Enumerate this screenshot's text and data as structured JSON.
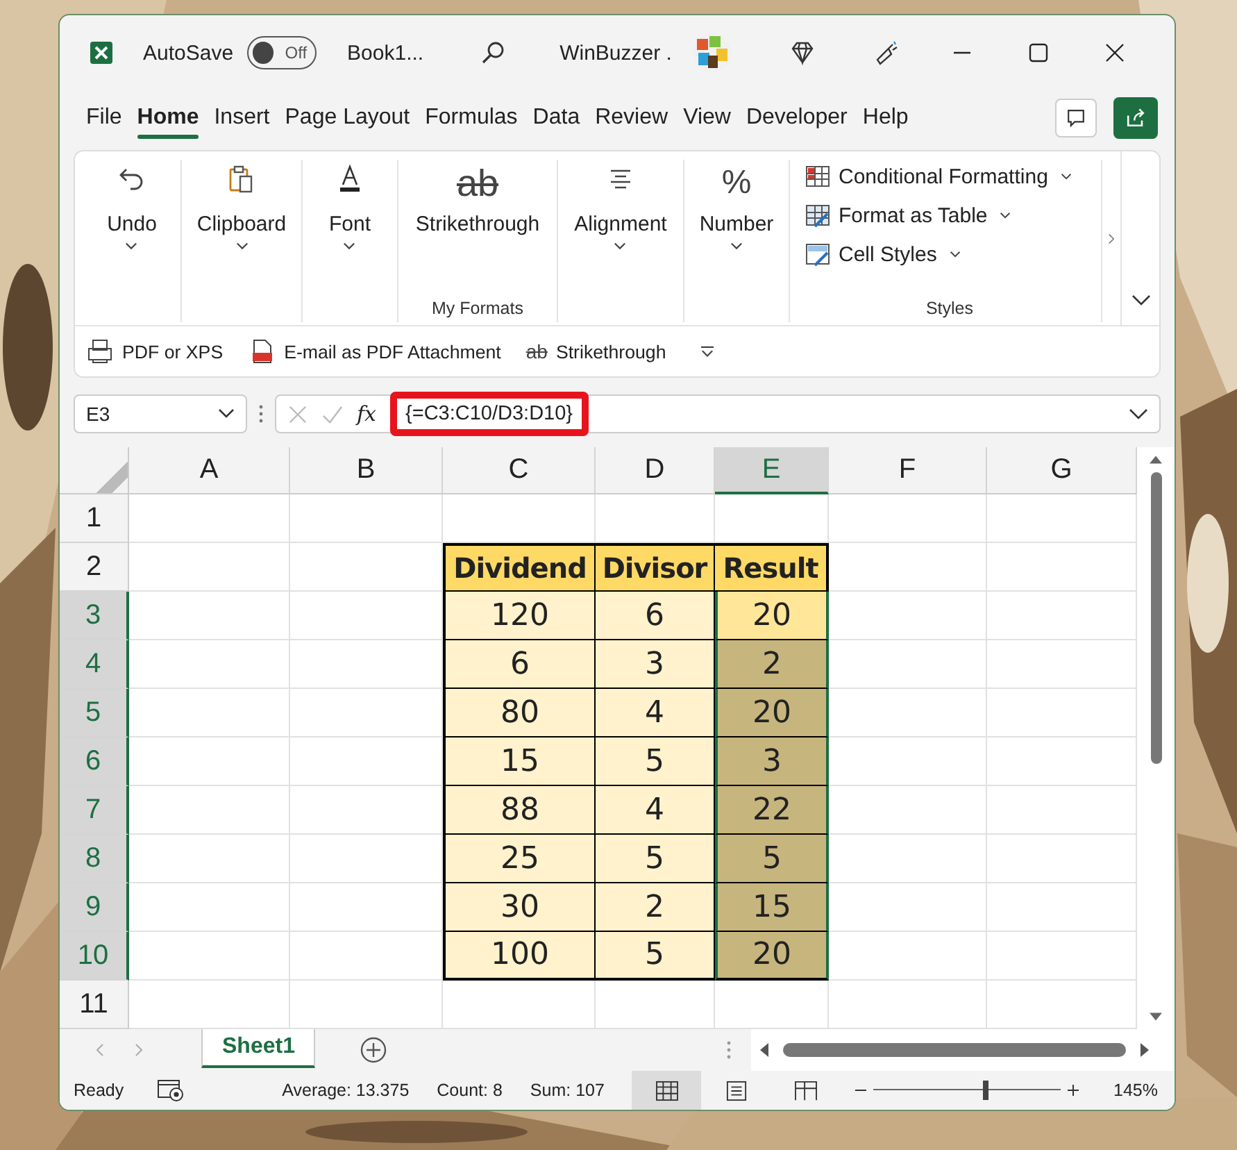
{
  "title_bar": {
    "autosave": {
      "label": "AutoSave",
      "on": false,
      "state_text": "Off"
    },
    "document": "Book1...",
    "account": "WinBuzzer ."
  },
  "menu_tabs": [
    {
      "label": "File",
      "selected": false
    },
    {
      "label": "Home",
      "selected": true
    },
    {
      "label": "Insert",
      "selected": false
    },
    {
      "label": "Page Layout",
      "selected": false
    },
    {
      "label": "Formulas",
      "selected": false
    },
    {
      "label": "Data",
      "selected": false
    },
    {
      "label": "Review",
      "selected": false
    },
    {
      "label": "View",
      "selected": false
    },
    {
      "label": "Developer",
      "selected": false
    },
    {
      "label": "Help",
      "selected": false
    }
  ],
  "ribbon": {
    "groups": [
      {
        "kind": "undo",
        "label": "Undo",
        "dropdown": true
      },
      {
        "kind": "clipboard",
        "label": "Clipboard",
        "dropdown": true
      },
      {
        "kind": "font",
        "label": "Font",
        "dropdown": true
      },
      {
        "kind": "glyph",
        "glyph": "ab",
        "label": "Strikethrough",
        "dropdown": false,
        "caption": "My Formats"
      },
      {
        "kind": "align",
        "label": "Alignment",
        "dropdown": true
      },
      {
        "kind": "text",
        "glyph": "%",
        "label": "Number",
        "dropdown": true
      }
    ],
    "styles": {
      "caption": "Styles",
      "items": [
        {
          "kind": "cond",
          "label": "Conditional Formatting"
        },
        {
          "kind": "table",
          "label": "Format as Table"
        },
        {
          "kind": "cellstyle",
          "label": "Cell Styles"
        }
      ]
    },
    "quick_access": [
      {
        "kind": "pdf",
        "label": "PDF or XPS"
      },
      {
        "kind": "email",
        "label": "E-mail as PDF Attachment"
      },
      {
        "kind": "strike",
        "glyph": "ab",
        "label": "Strikethrough"
      }
    ]
  },
  "formula_bar": {
    "name_box": "E3",
    "fx": "fx",
    "formula": "{=C3:C10/D3:D10}",
    "highlighted": true
  },
  "sheet": {
    "columns": [
      {
        "label": "A",
        "selected": false
      },
      {
        "label": "B",
        "selected": false
      },
      {
        "label": "C",
        "selected": false
      },
      {
        "label": "D",
        "selected": false
      },
      {
        "label": "E",
        "selected": true
      },
      {
        "label": "F",
        "selected": false
      },
      {
        "label": "G",
        "selected": false
      }
    ],
    "rows": [
      {
        "label": "1",
        "selected": false
      },
      {
        "label": "2",
        "selected": false
      },
      {
        "label": "3",
        "selected": true
      },
      {
        "label": "4",
        "selected": true
      },
      {
        "label": "5",
        "selected": true
      },
      {
        "label": "6",
        "selected": true
      },
      {
        "label": "7",
        "selected": true
      },
      {
        "label": "8",
        "selected": true
      },
      {
        "label": "9",
        "selected": true
      },
      {
        "label": "10",
        "selected": true
      },
      {
        "label": "11",
        "selected": false
      }
    ],
    "table": {
      "header": [
        "Dividend",
        "Divisor",
        "Result"
      ],
      "rows": [
        {
          "cells": [
            "120",
            "6",
            "20"
          ],
          "active": true
        },
        {
          "cells": [
            "6",
            "3",
            "2"
          ],
          "active": false
        },
        {
          "cells": [
            "80",
            "4",
            "20"
          ],
          "active": false
        },
        {
          "cells": [
            "15",
            "5",
            "3"
          ],
          "active": false
        },
        {
          "cells": [
            "88",
            "4",
            "22"
          ],
          "active": false
        },
        {
          "cells": [
            "25",
            "5",
            "5"
          ],
          "active": false
        },
        {
          "cells": [
            "30",
            "2",
            "15"
          ],
          "active": false
        },
        {
          "cells": [
            "100",
            "5",
            "20"
          ],
          "active": false
        }
      ]
    }
  },
  "sheet_tabs": [
    {
      "label": "Sheet1",
      "selected": true
    }
  ],
  "status_bar": {
    "mode": "Ready",
    "average": "Average: 13.375",
    "count": "Count: 8",
    "sum": "Sum: 107",
    "views": [
      {
        "kind": "normal",
        "selected": true
      },
      {
        "kind": "page",
        "selected": false
      },
      {
        "kind": "break",
        "selected": false
      }
    ],
    "zoom": {
      "level": 0.6,
      "text": "145%"
    }
  }
}
